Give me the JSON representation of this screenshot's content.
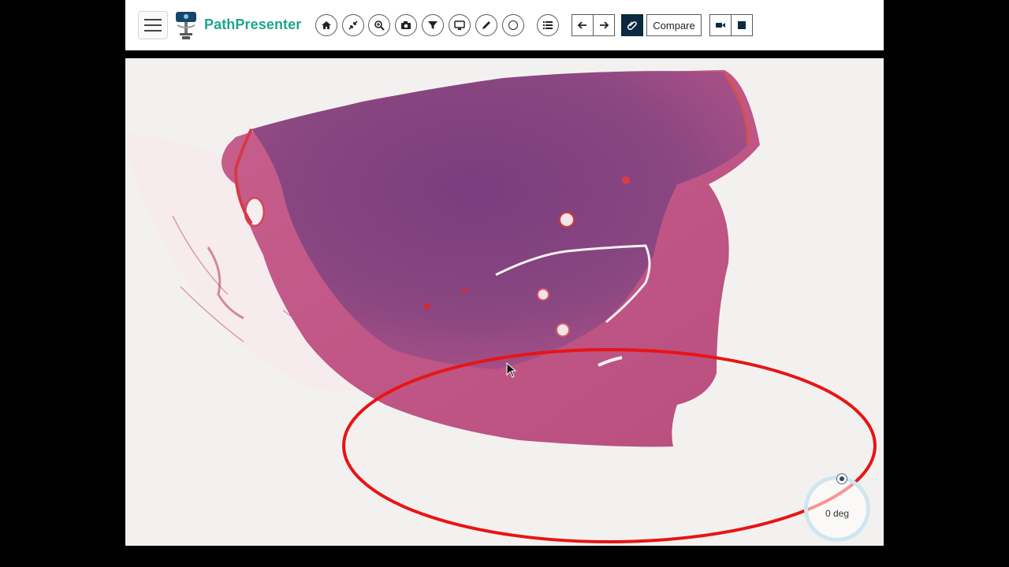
{
  "app": {
    "brand": "PathPresenter",
    "compare_label": "Compare"
  },
  "toolbar": {
    "tools": [
      {
        "name": "home",
        "icon": "home-icon"
      },
      {
        "name": "fit",
        "icon": "compress-icon"
      },
      {
        "name": "zoom",
        "icon": "zoom-icon"
      },
      {
        "name": "snapshot",
        "icon": "camera-icon"
      },
      {
        "name": "filter",
        "icon": "filter-icon"
      },
      {
        "name": "present",
        "icon": "monitor-icon"
      },
      {
        "name": "annotate",
        "icon": "pencil-icon"
      },
      {
        "name": "rotate",
        "icon": "circle-icon"
      },
      {
        "name": "list",
        "icon": "list-icon"
      }
    ],
    "nav": [
      {
        "name": "previous",
        "icon": "arrow-left-icon"
      },
      {
        "name": "next",
        "icon": "arrow-right-icon"
      }
    ],
    "record": [
      {
        "name": "video",
        "icon": "video-camera-icon"
      },
      {
        "name": "stop",
        "icon": "stop-icon"
      }
    ]
  },
  "viewer": {
    "rotation_label": "0 deg",
    "highlight_color": "#e81414"
  },
  "colors": {
    "brand": "#1fa58a",
    "tissue_dark": "#6b3572",
    "tissue_pink": "#c85a86"
  }
}
